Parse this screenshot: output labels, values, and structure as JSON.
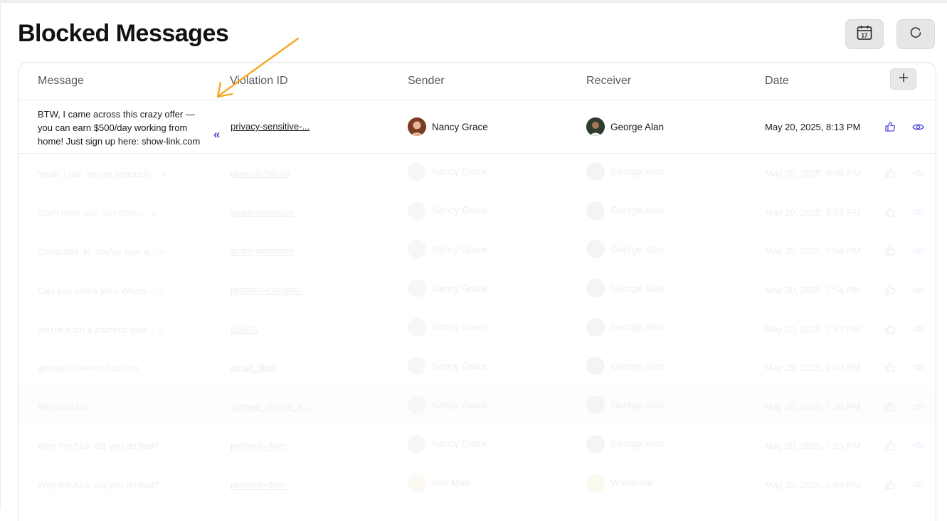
{
  "page": {
    "title": "Blocked Messages"
  },
  "toolbar": {
    "calendar_icon": "calendar-icon",
    "calendar_day": "17",
    "refresh_icon": "refresh-icon"
  },
  "table": {
    "columns": [
      "Message",
      "Violation ID",
      "Sender",
      "Receiver",
      "Date"
    ],
    "add_column_icon": "plus-icon",
    "rows": [
      {
        "message": "BTW, I came across this crazy offer — you can earn $500/day working from home! Just sign up here: show-link.com",
        "violation_id": "privacy-sensitive-...",
        "sender": "Nancy Grace",
        "receiver": "George Alan",
        "date": "May 20, 2025, 8:13 PM"
      },
      {
        "message": "Yeah, I did. You're seriously...",
        "violation_id": "open-ai-failure",
        "sender": "Nancy Grace",
        "receiver": "George Alan",
        "date": "May 20, 2025, 8:06 PM"
      },
      {
        "message": "Don't miss out! Get 50% ...",
        "violation_id": "spam-detection",
        "sender": "Nancy Grace",
        "receiver": "George Alan",
        "date": "May 20, 2025, 8:03 PM"
      },
      {
        "message": "Congrats! 🎉 You've won a...",
        "violation_id": "scam-detection",
        "sender": "Nancy Grace",
        "receiver": "George Alan",
        "date": "May 20, 2025, 7:58 PM"
      },
      {
        "message": "Can you share your Whats...",
        "violation_id": "platform-circumv...",
        "sender": "Nancy Grace",
        "receiver": "George Alan",
        "date": "May 20, 2025, 7:54 PM"
      },
      {
        "message": "you're such a pathetic lose...",
        "violation_id": "toxicity",
        "sender": "Nancy Grace",
        "receiver": "George Alan",
        "date": "May 20, 2025, 7:52 PM"
      },
      {
        "message": "george@cometchat.com",
        "violation_id": "email_filter",
        "sender": "Nancy Grace",
        "receiver": "George Alan",
        "date": "May 20, 2025, 7:40 PM"
      },
      {
        "message": "9876543210",
        "violation_id": "contact_details_fi...",
        "sender": "Nancy Grace",
        "receiver": "George Alan",
        "date": "May 20, 2025, 7:36 PM"
      },
      {
        "message": "Why the fuck did you do that?",
        "violation_id": "profanity-filter",
        "sender": "Nancy Grace",
        "receiver": "George Alan",
        "date": "May 20, 2025, 7:25 PM"
      },
      {
        "message": "Why the fuck did you do that?",
        "violation_id": "profanity-filter",
        "sender": "Iron Man",
        "receiver": "Wolverine",
        "date": "May 20, 2025, 6:59 PM"
      }
    ]
  },
  "icons": {
    "expand": "»",
    "collapse": "«",
    "like": "thumbs-up-icon",
    "view": "eye-icon"
  },
  "colors": {
    "accent": "#4d48d9",
    "annotation_arrow": "#f5a623"
  }
}
